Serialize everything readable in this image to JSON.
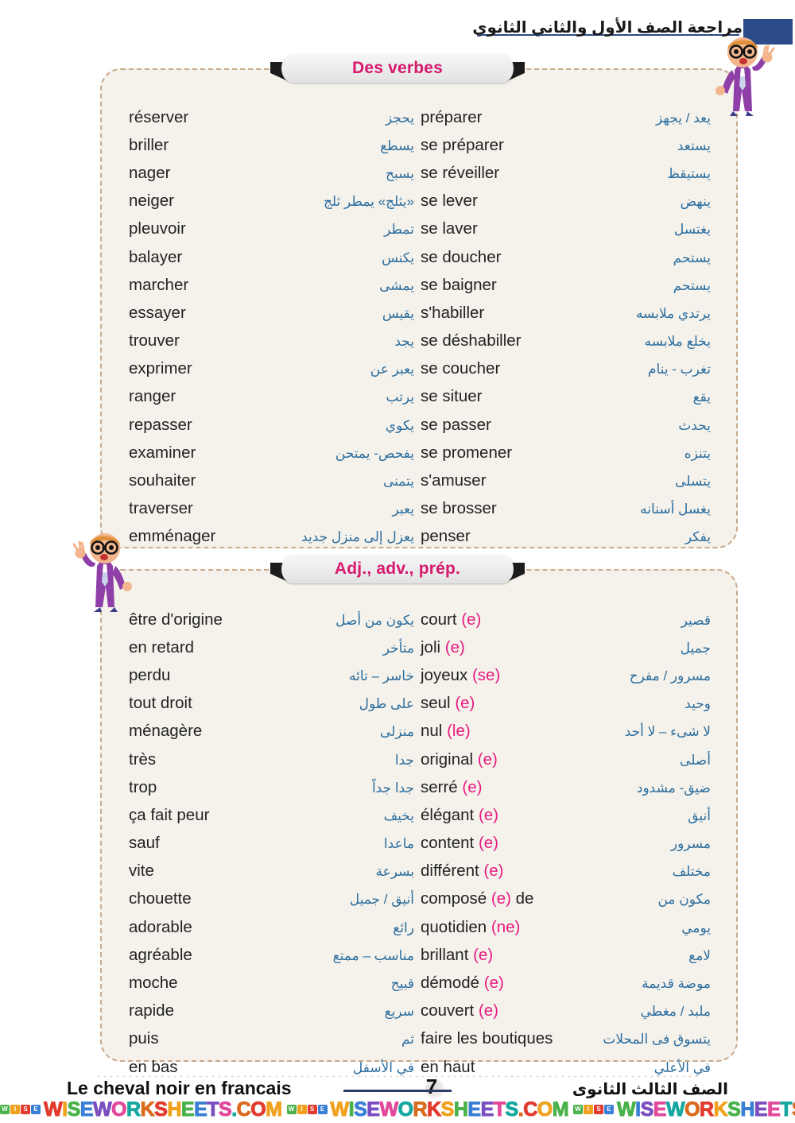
{
  "header": {
    "title_ar": "مراجعة الصف الأول والثاني الثانوي"
  },
  "sections": [
    {
      "id": "verbs",
      "banner": "Des verbes",
      "rows": [
        {
          "l_fr": "réserver",
          "l_ar": "يحجز",
          "r_fr": "préparer",
          "r_ar": "يعد / يجهز"
        },
        {
          "l_fr": "briller",
          "l_ar": "يسطع",
          "r_fr": "se préparer",
          "r_ar": "يستعد"
        },
        {
          "l_fr": "nager",
          "l_ar": "يسبح",
          "r_fr": "se réveiller",
          "r_ar": "يستيقظ"
        },
        {
          "l_fr": "neiger",
          "l_ar": "«يثلج» يمطر ثلج",
          "r_fr": "se lever",
          "r_ar": "ينهض"
        },
        {
          "l_fr": "pleuvoir",
          "l_ar": "تمطر",
          "r_fr": "se laver",
          "r_ar": "يغتسل"
        },
        {
          "l_fr": "balayer",
          "l_ar": "يكنس",
          "r_fr": "se doucher",
          "r_ar": "يستحم"
        },
        {
          "l_fr": "marcher",
          "l_ar": "يمشى",
          "r_fr": "se baigner",
          "r_ar": "يستحم"
        },
        {
          "l_fr": "essayer",
          "l_ar": "يقيس",
          "r_fr": "s'habiller",
          "r_ar": "يرتدي ملابسه"
        },
        {
          "l_fr": "trouver",
          "l_ar": "يجد",
          "r_fr": "se déshabiller",
          "r_ar": "يخلع ملابسه"
        },
        {
          "l_fr": "exprimer",
          "l_ar": "يعبر عن",
          "r_fr": "se coucher",
          "r_ar": "تغرب -  ينام"
        },
        {
          "l_fr": "ranger",
          "l_ar": "يرتب",
          "r_fr": "se situer",
          "r_ar": "يقع"
        },
        {
          "l_fr": "repasser",
          "l_ar": "يكوي",
          "r_fr": "se passer",
          "r_ar": "يحدث"
        },
        {
          "l_fr": "examiner",
          "l_ar": "يفحص- يمتحن",
          "r_fr": "se promener",
          "r_ar": "يتنزه"
        },
        {
          "l_fr": "souhaiter",
          "l_ar": "يتمنى",
          "r_fr": "s'amuser",
          "r_ar": "يتسلى"
        },
        {
          "l_fr": "traverser",
          "l_ar": "يعبر",
          "r_fr": "se brosser",
          "r_ar": "يغسل أسنانه"
        },
        {
          "l_fr": "emménager",
          "l_ar": "يعزل إلى منزل جديد",
          "r_fr": "penser",
          "r_ar": "يفكر"
        }
      ]
    },
    {
      "id": "adj",
      "banner": "Adj., adv., prép.",
      "rows": [
        {
          "l_fr": "être d'origine",
          "l_ar": "يكون من أصل",
          "r_fr": "court ",
          "r_sfx": "(e)",
          "r_ar": "قصير"
        },
        {
          "l_fr": "en retard",
          "l_ar": "متأخر",
          "r_fr": "joli ",
          "r_sfx": "(e)",
          "r_ar": "جميل"
        },
        {
          "l_fr": "perdu",
          "l_ar": "خاسر – تائه",
          "r_fr": "joyeux ",
          "r_sfx": "(se)",
          "r_ar": "مسرور / مفرح"
        },
        {
          "l_fr": "tout droit",
          "l_ar": "على طول",
          "r_fr": "seul ",
          "r_sfx": "(e)",
          "r_ar": "وحيد"
        },
        {
          "l_fr": "ménagère",
          "l_ar": "منزلى",
          "r_fr": "nul ",
          "r_sfx": "(le)",
          "r_ar": "لا شىء – لا أحد"
        },
        {
          "l_fr": "très",
          "l_ar": "جدا",
          "r_fr": "original ",
          "r_sfx": "(e)",
          "r_ar": "أصلى"
        },
        {
          "l_fr": "trop",
          "l_ar": "جدا جداً",
          "r_fr": "serré ",
          "r_sfx": "(e)",
          "r_ar": "ضيق- مشدود"
        },
        {
          "l_fr": "ça fait peur",
          "l_ar": "يخيف",
          "r_fr": "élégant ",
          "r_sfx": "(e)",
          "r_ar": "أنيق"
        },
        {
          "l_fr": "sauf",
          "l_ar": "ماعدا",
          "r_fr": "content ",
          "r_sfx": "(e)",
          "r_ar": "مسرور"
        },
        {
          "l_fr": "vite",
          "l_ar": "بسرعة",
          "r_fr": "différent ",
          "r_sfx": "(e)",
          "r_ar": "مختلف"
        },
        {
          "l_fr": "chouette",
          "l_ar": "أنيق / جميل",
          "r_fr": "composé ",
          "r_sfx": "(e)",
          "r_fr2": " de",
          "r_ar": "مكون من"
        },
        {
          "l_fr": "adorable",
          "l_ar": "رائع",
          "r_fr": "quotidien ",
          "r_sfx": "(ne)",
          "r_ar": "يومي"
        },
        {
          "l_fr": "agréable",
          "l_ar": "مناسب – ممتع",
          "r_fr": "brillant ",
          "r_sfx": "(e)",
          "r_ar": "لامع"
        },
        {
          "l_fr": "moche",
          "l_ar": "قبيح",
          "r_fr": "démodé ",
          "r_sfx": "(e)",
          "r_ar": "موضة قديمة"
        },
        {
          "l_fr": "rapide",
          "l_ar": "سريع",
          "r_fr": "couvert ",
          "r_sfx": "(e)",
          "r_ar": "ملبد / مغطي"
        },
        {
          "l_fr": "puis",
          "l_ar": "ثم",
          "r_fr": "faire les boutiques",
          "r_sfx": "",
          "r_ar": "يتسوق فى المحلات"
        },
        {
          "l_fr": "en bas",
          "l_ar": "في الأسفل",
          "r_fr": "en haut",
          "r_sfx": "",
          "r_ar": "في الأعلي"
        }
      ]
    }
  ],
  "footer": {
    "title_fr": "Le cheval noir en francais",
    "page": "7",
    "title_ar": "الصف الثالث الثانوى"
  },
  "watermark": {
    "badges": [
      "W",
      "I",
      "S",
      "E"
    ],
    "text": "WISEWORKSHEETS.COM"
  },
  "colors": {
    "pink": "#d61a6e",
    "suffix_pink": "#e8197e",
    "arabic_blue": "#2c6e9e",
    "navy": "#2d4a8a",
    "card_bg": "#f5f2ec",
    "dashed_border": "#c9a98a"
  }
}
